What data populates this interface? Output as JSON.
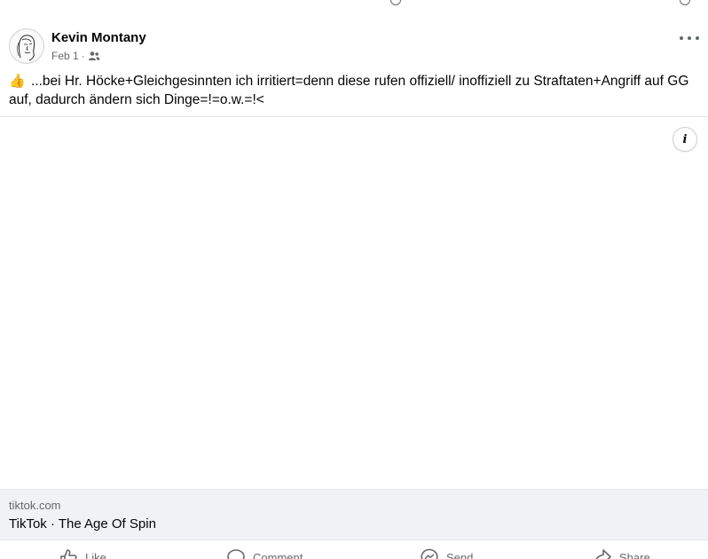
{
  "post": {
    "author": "Kevin Montany",
    "date": "Feb 1",
    "separator": "·",
    "audience_icon": "friends-icon",
    "emoji": "👍",
    "text": "...bei Hr. Höcke+Gleichgesinnten ich irritiert=denn diese rufen offiziell/ inoffiziell zu Straftaten+Angriff auf GG auf, dadurch ändern sich Dinge=!=o.w.=!<"
  },
  "media": {
    "info_label": "i"
  },
  "link": {
    "domain": "tiktok.com",
    "title": "TikTok · The Age Of Spin"
  },
  "actions": {
    "like": "Like",
    "comment": "Comment",
    "send": "Send",
    "share": "Share"
  }
}
